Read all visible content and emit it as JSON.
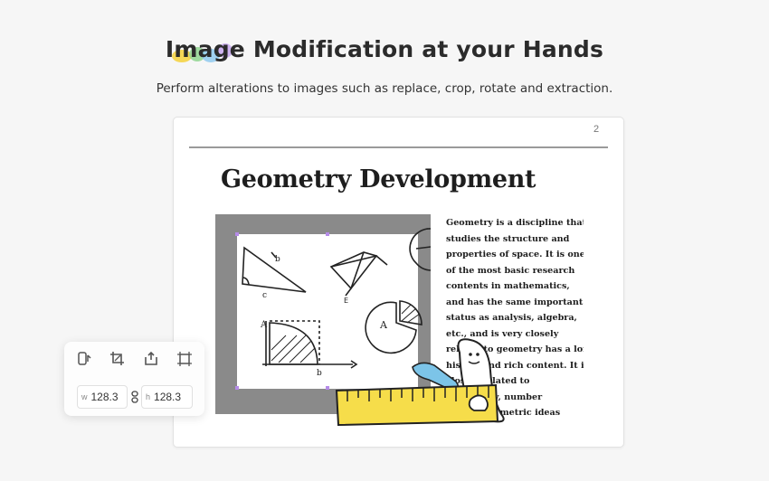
{
  "hero": {
    "headline_highlight": "Image",
    "headline_rest": " Modification at your Hands",
    "subtitle": "Perform alterations to images such as replace, crop, rotate and extraction."
  },
  "document": {
    "page_number": "2",
    "title": "Geometry Development",
    "body_lines": [
      "Geometry is a discipline that",
      "studies the structure and",
      "properties of space. It is one",
      "of the most basic research",
      "contents in mathematics,",
      "and has the same important",
      "status as analysis, algebra,",
      "etc., and is very closely",
      "related to geometry has a long",
      "history and rich content. It is",
      "closely related to",
      "philosophy, number",
      "theory, geometric ideas"
    ],
    "image_labels": {
      "a": "A",
      "b": "b",
      "c": "c",
      "e": "E"
    }
  },
  "image_toolbar": {
    "tools": [
      "replace-image",
      "crop",
      "extract",
      "rotate"
    ],
    "width_label": "w",
    "width_value": "128.3",
    "height_label": "h",
    "height_value": "128.3"
  },
  "colors": {
    "background": "#f6f6f6",
    "frame_gray": "#8a8a8a",
    "ruler_yellow": "#f6dd4a",
    "accent_blue": "#7cc4e8"
  }
}
